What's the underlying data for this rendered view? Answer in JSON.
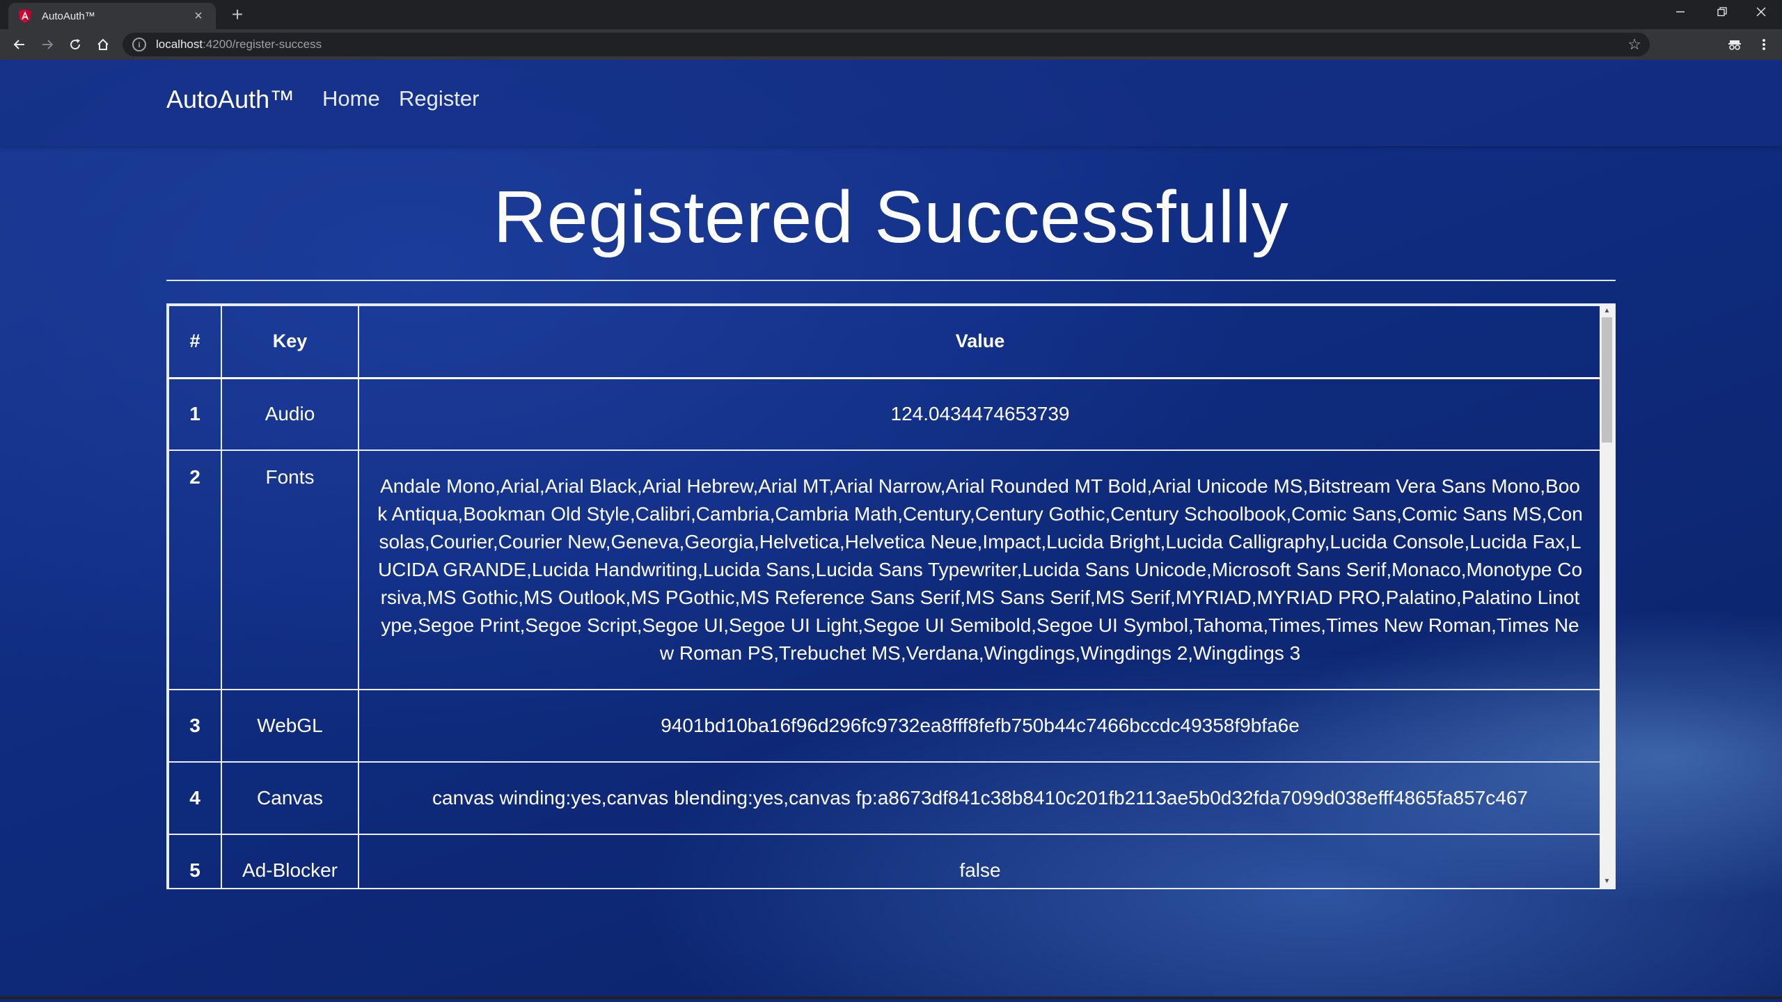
{
  "browser": {
    "tab_title": "AutoAuth™",
    "new_tab_label": "+",
    "tab_close_label": "×",
    "url_host": "localhost",
    "url_path": ":4200/register-success"
  },
  "navbar": {
    "brand": "AutoAuth™",
    "links": [
      "Home",
      "Register"
    ]
  },
  "heading": "Registered Successfully",
  "table": {
    "headers": [
      "#",
      "Key",
      "Value"
    ],
    "rows": [
      {
        "num": "1",
        "key": "Audio",
        "value": "124.0434474653739"
      },
      {
        "num": "2",
        "key": "Fonts",
        "value": "Andale Mono,Arial,Arial Black,Arial Hebrew,Arial MT,Arial Narrow,Arial Rounded MT Bold,Arial Unicode MS,Bitstream Vera Sans Mono,Book Antiqua,Bookman Old Style,Calibri,Cambria,Cambria Math,Century,Century Gothic,Century Schoolbook,Comic Sans,Comic Sans MS,Consolas,Courier,Courier New,Geneva,Georgia,Helvetica,Helvetica Neue,Impact,Lucida Bright,Lucida Calligraphy,Lucida Console,Lucida Fax,LUCIDA GRANDE,Lucida Handwriting,Lucida Sans,Lucida Sans Typewriter,Lucida Sans Unicode,Microsoft Sans Serif,Monaco,Monotype Corsiva,MS Gothic,MS Outlook,MS PGothic,MS Reference Sans Serif,MS Sans Serif,MS Serif,MYRIAD,MYRIAD PRO,Palatino,Palatino Linotype,Segoe Print,Segoe Script,Segoe UI,Segoe UI Light,Segoe UI Semibold,Segoe UI Symbol,Tahoma,Times,Times New Roman,Times New Roman PS,Trebuchet MS,Verdana,Wingdings,Wingdings 2,Wingdings 3"
      },
      {
        "num": "3",
        "key": "WebGL",
        "value": "9401bd10ba16f96d296fc9732ea8fff8fefb750b44c7466bccdc49358f9bfa6e"
      },
      {
        "num": "4",
        "key": "Canvas",
        "value": "canvas winding:yes,canvas blending:yes,canvas fp:a8673df841c38b8410c201fb2113ae5b0d32fda7099d038efff4865fa857c467"
      },
      {
        "num": "5",
        "key": "Ad-Blocker",
        "value": "false"
      }
    ]
  },
  "colors": {
    "background": "#0d2a7a",
    "chrome_dark": "#202124",
    "chrome_toolbar": "#35363a",
    "angular_red": "#dd0031"
  }
}
